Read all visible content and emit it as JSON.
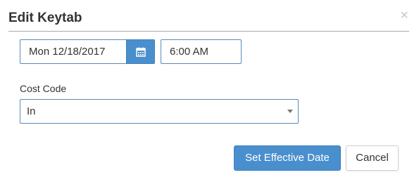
{
  "dialog": {
    "title": "Edit Keytab",
    "close_label": "×"
  },
  "effective": {
    "date_value": "Mon 12/18/2017",
    "time_value": "6:00 AM"
  },
  "cost_code": {
    "label": "Cost Code",
    "selected": "In"
  },
  "actions": {
    "primary_label": "Set Effective Date",
    "cancel_label": "Cancel"
  },
  "icons": {
    "calendar": "calendar-icon",
    "close": "close-icon",
    "dropdown": "chevron-down-icon"
  },
  "colors": {
    "accent": "#4a8fcd",
    "input_border": "#5b8ab8",
    "text": "#333333"
  }
}
